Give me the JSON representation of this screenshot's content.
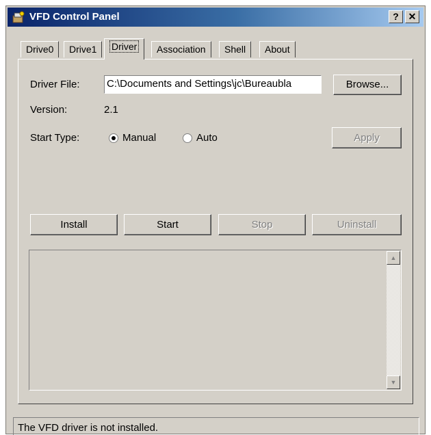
{
  "window": {
    "title": "VFD Control Panel",
    "help_label": "?",
    "close_label": "✕"
  },
  "tabs": [
    {
      "label": "Drive0"
    },
    {
      "label": "Drive1"
    },
    {
      "label": "Driver",
      "active": true
    },
    {
      "label": "Association"
    },
    {
      "label": "Shell"
    },
    {
      "label": "About"
    }
  ],
  "driver": {
    "file_label": "Driver File:",
    "file_value": "C:\\Documents and Settings\\jc\\Bureaubla",
    "browse_label": "Browse...",
    "version_label": "Version:",
    "version_value": "2.1",
    "start_type_label": "Start Type:",
    "manual_label": "Manual",
    "auto_label": "Auto",
    "selected_start_type": "Manual",
    "apply_label": "Apply",
    "install_label": "Install",
    "start_label": "Start",
    "stop_label": "Stop",
    "uninstall_label": "Uninstall",
    "log_text": ""
  },
  "status": {
    "text": "The VFD driver is not installed."
  },
  "icons": {
    "app": "vfd-app-icon",
    "scroll_up": "arrow-up-icon",
    "scroll_down": "arrow-down-icon"
  },
  "colors": {
    "titlebar_start": "#0a246a",
    "titlebar_end": "#a6caf0",
    "face": "#d4d0c8"
  }
}
